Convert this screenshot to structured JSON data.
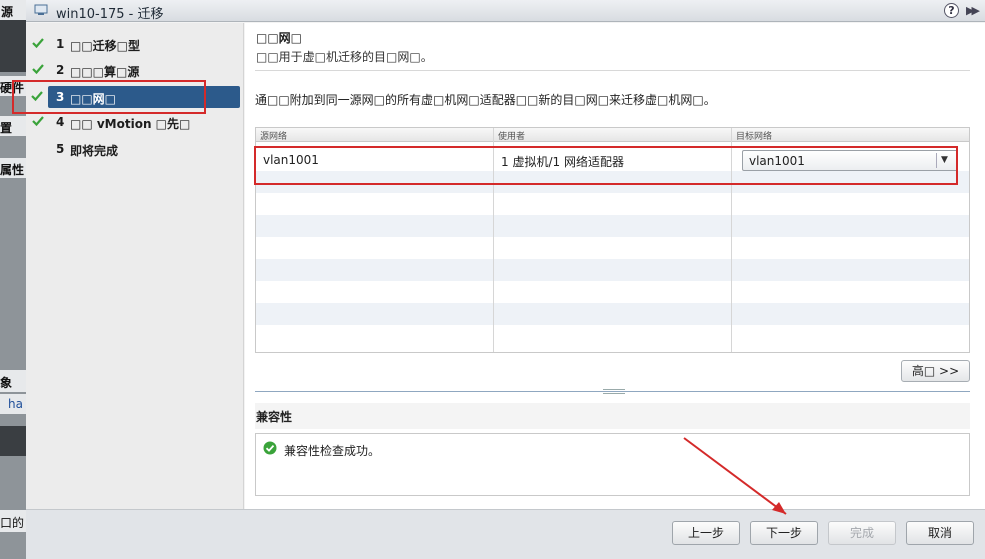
{
  "background_panel": {
    "items": [
      "源",
      "硬件",
      "置",
      "属性",
      "象",
      "ha",
      "口的"
    ]
  },
  "dialog": {
    "title": "win10-175 - 迁移",
    "help_label": "?",
    "expand_label": "▶▶"
  },
  "steps": [
    {
      "num": "1",
      "label": "□□迁移□型",
      "done": true
    },
    {
      "num": "2",
      "label": "□□□算□源",
      "done": true
    },
    {
      "num": "3",
      "label": "□□网□",
      "done": true,
      "active": true
    },
    {
      "num": "4",
      "label": "□□ vMotion □先□",
      "done": true
    },
    {
      "num": "5",
      "label": "即将完成",
      "done": false
    }
  ],
  "page": {
    "title": "□□网□",
    "description": "□□用于虚□机迁移的目□网□。",
    "instruction": "通□□附加到同一源网□的所有虚□机网□适配器□□新的目□网□来迁移虚□机网□。"
  },
  "network_table": {
    "columns": [
      "源网络",
      "使用者",
      "目标网络"
    ],
    "rows": [
      {
        "source": "vlan1001",
        "used_by": "1 虚拟机/1 网络适配器",
        "target": "vlan1001"
      }
    ]
  },
  "advanced_button": "高□ >>",
  "compat": {
    "title": "兼容性",
    "message": "兼容性检查成功。"
  },
  "footer": {
    "back": "上一步",
    "next": "下一步",
    "finish": "完成",
    "cancel": "取消"
  },
  "colors": {
    "active_step": "#2c5a8b",
    "check": "#3aa33a",
    "annotation": "#d42a2a"
  }
}
